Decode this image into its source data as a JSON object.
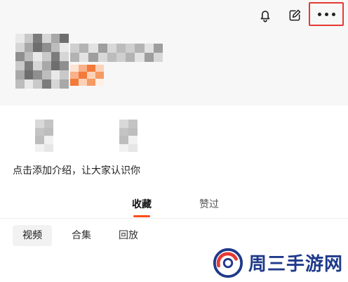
{
  "header": {
    "icons": {
      "bell": "bell-icon",
      "edit": "edit-icon",
      "more": "more-icon"
    }
  },
  "profile": {
    "intro_prompt": "点击添加介绍，让大家认识你"
  },
  "tabs": [
    {
      "label": "收藏",
      "active": true
    },
    {
      "label": "赞过",
      "active": false
    }
  ],
  "subtabs": [
    {
      "label": "视频",
      "active": true
    },
    {
      "label": "合集",
      "active": false
    },
    {
      "label": "回放",
      "active": false
    }
  ],
  "watermark": {
    "text": "周三手游网"
  },
  "colors": {
    "accent": "#ff4d1a",
    "highlight_border": "#e53935",
    "watermark_blue": "#1f3a8a",
    "watermark_red": "#e53935"
  }
}
